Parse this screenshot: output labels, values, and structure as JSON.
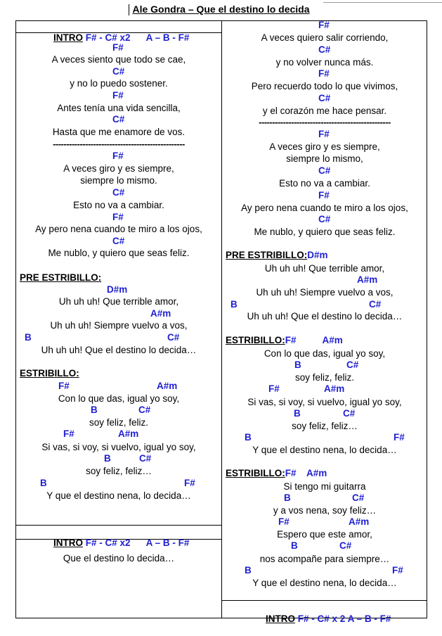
{
  "title": "Ale Gondra – Que el destino lo decida",
  "intro": {
    "label": "INTRO",
    "a": "F# - C# x2",
    "b": "A – B - F#"
  },
  "intro_bottom": {
    "label": "INTRO",
    "a": "F# - C# x 2",
    "b": "A – B - F#"
  },
  "dashes": "-------------------------------------------------",
  "left": {
    "v1": [
      {
        "chord": "F#",
        "lyric": "A veces siento que todo se cae,"
      },
      {
        "chord": "C#",
        "lyric": "y no lo puedo sostener."
      },
      {
        "chord": "F#",
        "lyric": "Antes tenía una vida sencilla,"
      },
      {
        "chord": "C#",
        "lyric": "Hasta que me enamore de vos."
      }
    ],
    "v2": [
      {
        "chord": "F#",
        "lyric": "A veces giro y es siempre,"
      },
      {
        "chord": "",
        "lyric": "siempre lo mismo."
      },
      {
        "chord": "C#",
        "lyric": "Esto no va a cambiar."
      },
      {
        "chord": "F#",
        "lyric": "Ay pero nena cuando te miro a los ojos,"
      },
      {
        "chord": "C#",
        "lyric": "Me nublo, y quiero que seas feliz."
      }
    ],
    "pre_label": "PRE ESTRIBILLO:",
    "pre": {
      "c1": "D#m",
      "l1": "Uh uh uh! Que terrible amor,",
      "c2": "A#m",
      "l2": "Uh uh uh! Siempre vuelvo a vos,",
      "c3a": "B",
      "c3b": "C#",
      "l3": "Uh uh uh! Que el destino lo decida…"
    },
    "est_label": "ESTRIBILLO:",
    "est": {
      "c1a": "F#",
      "c1b": "A#m",
      "l1": "Con lo que das, igual yo soy,",
      "c2a": "B",
      "c2b": "C#",
      "l2": "soy feliz, feliz.",
      "c3a": "F#",
      "c3b": "A#m",
      "l3": "Si vas, si voy, si vuelvo, igual yo soy,",
      "c4a": "B",
      "c4b": "C#",
      "l4": "soy feliz, feliz…",
      "c5a": "B",
      "c5b": "F#",
      "l5": "Y que el destino nena, lo decida…"
    },
    "outro": "Que el destino lo decida…"
  },
  "right": {
    "v3": [
      {
        "chord": "F#",
        "lyric": "A veces quiero salir corriendo,"
      },
      {
        "chord": "C#",
        "lyric": "y no volver nunca más."
      },
      {
        "chord": "F#",
        "lyric": "Pero recuerdo todo lo que vivimos,"
      },
      {
        "chord": "C#",
        "lyric": "y el corazón me hace pensar."
      }
    ],
    "v4": [
      {
        "chord": "F#",
        "lyric": "A veces giro y es siempre,"
      },
      {
        "chord": "",
        "lyric": "siempre lo mismo,"
      },
      {
        "chord": "C#",
        "lyric": "Esto no va a cambiar."
      },
      {
        "chord": "F#",
        "lyric": "Ay pero nena cuando te miro a los ojos,"
      },
      {
        "chord": "C#",
        "lyric": "Me nublo, y quiero que seas feliz."
      }
    ],
    "pre_label": "PRE ESTRIBILLO:",
    "pre_chord": "D#m",
    "pre": {
      "l1": "Uh uh uh! Que terrible amor,",
      "c2": "A#m",
      "l2": "Uh uh uh! Siempre vuelvo a vos,",
      "c3a": "B",
      "c3b": "C#",
      "l3": "Uh uh uh! Que el destino lo decida…"
    },
    "est_label": "ESTRIBILLO:",
    "est_chord1": "F#",
    "est_chord2": "A#m",
    "est": {
      "l1": "Con lo que das, igual yo soy,",
      "c2a": "B",
      "c2b": "C#",
      "l2": "soy feliz, feliz.",
      "c3a": "F#",
      "c3b": "A#m",
      "l3": "Si vas, si voy, si vuelvo, igual yo soy,",
      "c4a": "B",
      "c4b": "C#",
      "l4": "soy feliz, feliz…",
      "c5a": "B",
      "c5b": "F#",
      "l5": "Y que el destino nena, lo decida…"
    },
    "est2_label": "ESTRIBILLO:",
    "est2_chord1": "F#",
    "est2_chord2": "A#m",
    "est2": {
      "l1": "Si tengo mi guitarra",
      "c2a": "B",
      "c2b": "C#",
      "l2": "y a vos nena, soy feliz…",
      "c3a": "F#",
      "c3b": "A#m",
      "l3": "Espero que este amor,",
      "c4a": "B",
      "c4b": "C#",
      "l4": "nos acompañe para siempre…",
      "c5a": "B",
      "c5b": "F#",
      "l5": "Y que el destino nena, lo decida…"
    }
  }
}
